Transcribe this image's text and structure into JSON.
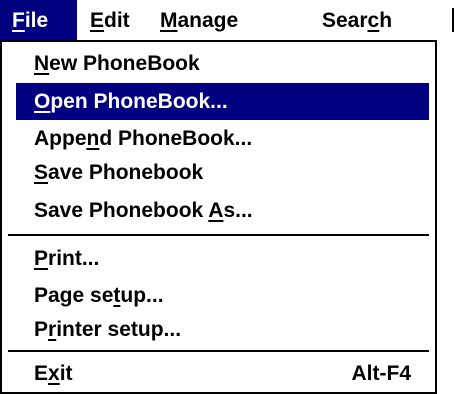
{
  "menubar": {
    "items": [
      {
        "label": "File",
        "mnemonic_index": 0,
        "active": true
      },
      {
        "label": "Edit",
        "mnemonic_index": 0,
        "active": false
      },
      {
        "label": "Manage",
        "mnemonic_index": 0,
        "active": false
      },
      {
        "label": "Search",
        "mnemonic_index": 4,
        "active": false
      }
    ]
  },
  "file_menu": {
    "items": [
      {
        "label": "New PhoneBook",
        "mnemonic_index": 0
      },
      {
        "label": "Open PhoneBook...",
        "mnemonic_index": 0,
        "highlighted": true
      },
      {
        "label": "Append PhoneBook...",
        "mnemonic_index": 4
      },
      {
        "label": "Save Phonebook",
        "mnemonic_index": 0
      },
      {
        "label": "Save Phonebook As...",
        "mnemonic_index": 15
      },
      {
        "label": "Print...",
        "mnemonic_index": 0
      },
      {
        "label": "Page setup...",
        "mnemonic_index": 7
      },
      {
        "label": "Printer setup...",
        "mnemonic_index": 1
      },
      {
        "label": "Exit",
        "mnemonic_index": 1,
        "accelerator": "Alt-F4"
      }
    ]
  },
  "colors": {
    "highlight_bg": "#000080",
    "highlight_fg": "#ffffff",
    "menu_bg": "#ffffff",
    "text": "#000000"
  }
}
